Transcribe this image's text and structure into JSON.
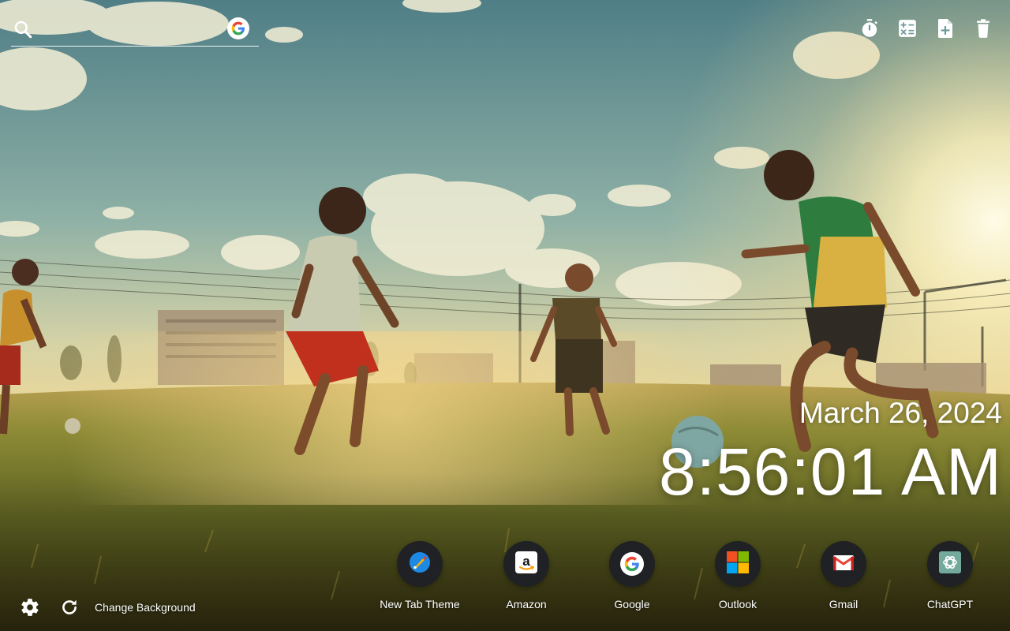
{
  "search": {
    "placeholder": "",
    "engine_icon": "google-icon"
  },
  "tools": [
    {
      "name": "timer-icon"
    },
    {
      "name": "calculator-icon"
    },
    {
      "name": "new-note-icon"
    },
    {
      "name": "trash-icon"
    }
  ],
  "clock": {
    "date": "March 26, 2024",
    "time": "8:56:01 AM"
  },
  "shortcuts": [
    {
      "label": "New Tab Theme",
      "icon": "new-tab-theme-icon",
      "color": "#1e88e5"
    },
    {
      "label": "Amazon",
      "icon": "amazon-icon",
      "color": "#ffffff"
    },
    {
      "label": "Google",
      "icon": "google-icon",
      "color": "#ffffff"
    },
    {
      "label": "Outlook",
      "icon": "microsoft-icon",
      "color": "#f25022"
    },
    {
      "label": "Gmail",
      "icon": "gmail-icon",
      "color": "#ea4335"
    },
    {
      "label": "ChatGPT",
      "icon": "chatgpt-icon",
      "color": "#74aa9c"
    }
  ],
  "footer": {
    "change_background_label": "Change Background"
  },
  "colors": {
    "sky_top": "#5f8a8e",
    "sky_horizon": "#e9d99a",
    "sun": "#fff4c8",
    "grass": "#6d6a1e",
    "text": "#ffffff"
  }
}
